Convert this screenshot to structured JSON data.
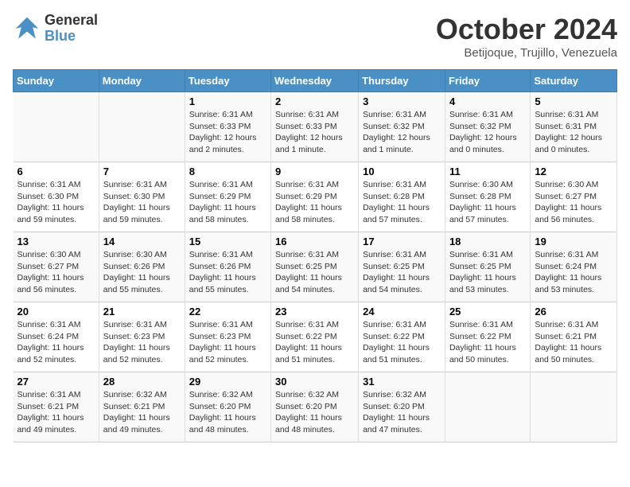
{
  "logo": {
    "text_general": "General",
    "text_blue": "Blue"
  },
  "header": {
    "month": "October 2024",
    "location": "Betijoque, Trujillo, Venezuela"
  },
  "days_of_week": [
    "Sunday",
    "Monday",
    "Tuesday",
    "Wednesday",
    "Thursday",
    "Friday",
    "Saturday"
  ],
  "weeks": [
    [
      {
        "day": "",
        "info": ""
      },
      {
        "day": "",
        "info": ""
      },
      {
        "day": "1",
        "info": "Sunrise: 6:31 AM\nSunset: 6:33 PM\nDaylight: 12 hours\nand 2 minutes."
      },
      {
        "day": "2",
        "info": "Sunrise: 6:31 AM\nSunset: 6:33 PM\nDaylight: 12 hours\nand 1 minute."
      },
      {
        "day": "3",
        "info": "Sunrise: 6:31 AM\nSunset: 6:32 PM\nDaylight: 12 hours\nand 1 minute."
      },
      {
        "day": "4",
        "info": "Sunrise: 6:31 AM\nSunset: 6:32 PM\nDaylight: 12 hours\nand 0 minutes."
      },
      {
        "day": "5",
        "info": "Sunrise: 6:31 AM\nSunset: 6:31 PM\nDaylight: 12 hours\nand 0 minutes."
      }
    ],
    [
      {
        "day": "6",
        "info": "Sunrise: 6:31 AM\nSunset: 6:30 PM\nDaylight: 11 hours\nand 59 minutes."
      },
      {
        "day": "7",
        "info": "Sunrise: 6:31 AM\nSunset: 6:30 PM\nDaylight: 11 hours\nand 59 minutes."
      },
      {
        "day": "8",
        "info": "Sunrise: 6:31 AM\nSunset: 6:29 PM\nDaylight: 11 hours\nand 58 minutes."
      },
      {
        "day": "9",
        "info": "Sunrise: 6:31 AM\nSunset: 6:29 PM\nDaylight: 11 hours\nand 58 minutes."
      },
      {
        "day": "10",
        "info": "Sunrise: 6:31 AM\nSunset: 6:28 PM\nDaylight: 11 hours\nand 57 minutes."
      },
      {
        "day": "11",
        "info": "Sunrise: 6:30 AM\nSunset: 6:28 PM\nDaylight: 11 hours\nand 57 minutes."
      },
      {
        "day": "12",
        "info": "Sunrise: 6:30 AM\nSunset: 6:27 PM\nDaylight: 11 hours\nand 56 minutes."
      }
    ],
    [
      {
        "day": "13",
        "info": "Sunrise: 6:30 AM\nSunset: 6:27 PM\nDaylight: 11 hours\nand 56 minutes."
      },
      {
        "day": "14",
        "info": "Sunrise: 6:30 AM\nSunset: 6:26 PM\nDaylight: 11 hours\nand 55 minutes."
      },
      {
        "day": "15",
        "info": "Sunrise: 6:31 AM\nSunset: 6:26 PM\nDaylight: 11 hours\nand 55 minutes."
      },
      {
        "day": "16",
        "info": "Sunrise: 6:31 AM\nSunset: 6:25 PM\nDaylight: 11 hours\nand 54 minutes."
      },
      {
        "day": "17",
        "info": "Sunrise: 6:31 AM\nSunset: 6:25 PM\nDaylight: 11 hours\nand 54 minutes."
      },
      {
        "day": "18",
        "info": "Sunrise: 6:31 AM\nSunset: 6:25 PM\nDaylight: 11 hours\nand 53 minutes."
      },
      {
        "day": "19",
        "info": "Sunrise: 6:31 AM\nSunset: 6:24 PM\nDaylight: 11 hours\nand 53 minutes."
      }
    ],
    [
      {
        "day": "20",
        "info": "Sunrise: 6:31 AM\nSunset: 6:24 PM\nDaylight: 11 hours\nand 52 minutes."
      },
      {
        "day": "21",
        "info": "Sunrise: 6:31 AM\nSunset: 6:23 PM\nDaylight: 11 hours\nand 52 minutes."
      },
      {
        "day": "22",
        "info": "Sunrise: 6:31 AM\nSunset: 6:23 PM\nDaylight: 11 hours\nand 52 minutes."
      },
      {
        "day": "23",
        "info": "Sunrise: 6:31 AM\nSunset: 6:22 PM\nDaylight: 11 hours\nand 51 minutes."
      },
      {
        "day": "24",
        "info": "Sunrise: 6:31 AM\nSunset: 6:22 PM\nDaylight: 11 hours\nand 51 minutes."
      },
      {
        "day": "25",
        "info": "Sunrise: 6:31 AM\nSunset: 6:22 PM\nDaylight: 11 hours\nand 50 minutes."
      },
      {
        "day": "26",
        "info": "Sunrise: 6:31 AM\nSunset: 6:21 PM\nDaylight: 11 hours\nand 50 minutes."
      }
    ],
    [
      {
        "day": "27",
        "info": "Sunrise: 6:31 AM\nSunset: 6:21 PM\nDaylight: 11 hours\nand 49 minutes."
      },
      {
        "day": "28",
        "info": "Sunrise: 6:32 AM\nSunset: 6:21 PM\nDaylight: 11 hours\nand 49 minutes."
      },
      {
        "day": "29",
        "info": "Sunrise: 6:32 AM\nSunset: 6:20 PM\nDaylight: 11 hours\nand 48 minutes."
      },
      {
        "day": "30",
        "info": "Sunrise: 6:32 AM\nSunset: 6:20 PM\nDaylight: 11 hours\nand 48 minutes."
      },
      {
        "day": "31",
        "info": "Sunrise: 6:32 AM\nSunset: 6:20 PM\nDaylight: 11 hours\nand 47 minutes."
      },
      {
        "day": "",
        "info": ""
      },
      {
        "day": "",
        "info": ""
      }
    ]
  ]
}
